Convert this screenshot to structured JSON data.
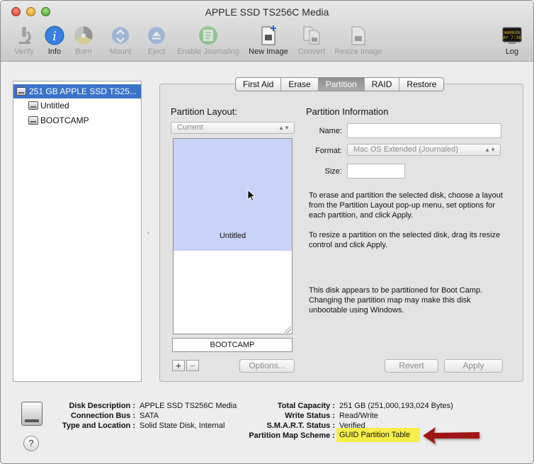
{
  "window": {
    "title": "APPLE SSD TS256C Media"
  },
  "toolbar": {
    "verify": "Verify",
    "info": "Info",
    "burn": "Burn",
    "mount": "Mount",
    "eject": "Eject",
    "enable_journaling": "Enable Journaling",
    "new_image": "New Image",
    "convert": "Convert",
    "resize_image": "Resize Image",
    "log": "Log",
    "log_icon_text": "WARNIN\nAY 7:36"
  },
  "sidebar": {
    "disk": "251 GB APPLE SSD TS25...",
    "volumes": [
      "Untitled",
      "BOOTCAMP"
    ]
  },
  "tabs": [
    "First Aid",
    "Erase",
    "Partition",
    "RAID",
    "Restore"
  ],
  "active_tab": "Partition",
  "partition_layout": {
    "title": "Partition Layout:",
    "selected": "Current",
    "partitions": [
      "Untitled",
      "BOOTCAMP"
    ],
    "add": "+",
    "remove": "−",
    "options_button": "Options..."
  },
  "partition_info": {
    "title": "Partition Information",
    "name_label": "Name:",
    "name_value": "",
    "format_label": "Format:",
    "format_value": "Mac OS Extended (Journaled)",
    "size_label": "Size:",
    "size_value": "",
    "para1": "To erase and partition the selected disk, choose a layout from the Partition Layout pop-up menu, set options for each partition, and click Apply.",
    "para2": "To resize a partition on the selected disk, drag its resize control and click Apply.",
    "para3": "This disk appears to be partitioned for Boot Camp. Changing the partition map may make this disk unbootable using Windows.",
    "revert_button": "Revert",
    "apply_button": "Apply"
  },
  "disk_info": {
    "disk_description_label": "Disk Description :",
    "disk_description_value": "APPLE SSD TS256C Media",
    "connection_bus_label": "Connection Bus :",
    "connection_bus_value": "SATA",
    "type_location_label": "Type and Location :",
    "type_location_value": "Solid State Disk, Internal",
    "total_capacity_label": "Total Capacity :",
    "total_capacity_value": "251 GB (251,000,193,024 Bytes)",
    "write_status_label": "Write Status :",
    "write_status_value": "Read/Write",
    "smart_status_label": "S.M.A.R.T. Status :",
    "smart_status_value": "Verified",
    "partition_map_label": "Partition Map Scheme :",
    "partition_map_value": "GUID Partition Table"
  },
  "help": "?",
  "colors": {
    "highlight": "#f6ee4a",
    "arrow": "#a01414",
    "selection": "#3a73c9",
    "partition_fill": "#c9d2f7"
  }
}
